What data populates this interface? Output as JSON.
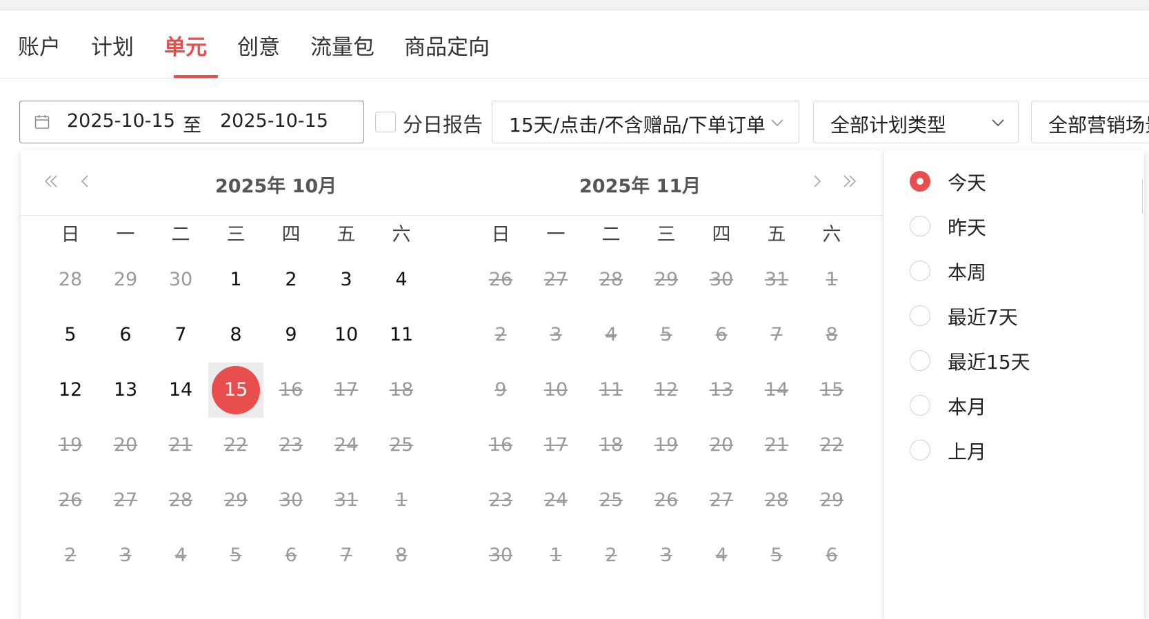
{
  "tabs": {
    "items": [
      {
        "label": "账户",
        "active": false
      },
      {
        "label": "计划",
        "active": false
      },
      {
        "label": "单元",
        "active": true
      },
      {
        "label": "创意",
        "active": false
      },
      {
        "label": "流量包",
        "active": false
      },
      {
        "label": "商品定向",
        "active": false
      }
    ]
  },
  "filters": {
    "date_start": "2025-10-15",
    "date_separator": "至",
    "date_end": "2025-10-15",
    "daily_report_label": "分日报告",
    "daily_report_checked": false,
    "attribution_select": "15天/点击/不含赠品/下单订单",
    "plan_type_select": "全部计划类型",
    "scene_select": "全部营销场景"
  },
  "calendar": {
    "weekdays": [
      "日",
      "一",
      "二",
      "三",
      "四",
      "五",
      "六"
    ],
    "selected_date": "2025-10-15",
    "months": [
      {
        "title": "2025年 10月",
        "weeks": [
          [
            "28",
            "29",
            "30",
            "1",
            "2",
            "3",
            "4"
          ],
          [
            "5",
            "6",
            "7",
            "8",
            "9",
            "10",
            "11"
          ],
          [
            "12",
            "13",
            "14",
            "15",
            "16",
            "17",
            "18"
          ],
          [
            "19",
            "20",
            "21",
            "22",
            "23",
            "24",
            "25"
          ],
          [
            "26",
            "27",
            "28",
            "29",
            "30",
            "31",
            "1"
          ],
          [
            "2",
            "3",
            "4",
            "5",
            "6",
            "7",
            "8"
          ]
        ]
      },
      {
        "title": "2025年 11月",
        "weeks": [
          [
            "26",
            "27",
            "28",
            "29",
            "30",
            "31",
            "1"
          ],
          [
            "2",
            "3",
            "4",
            "5",
            "6",
            "7",
            "8"
          ],
          [
            "9",
            "10",
            "11",
            "12",
            "13",
            "14",
            "15"
          ],
          [
            "16",
            "17",
            "18",
            "19",
            "20",
            "21",
            "22"
          ],
          [
            "23",
            "24",
            "25",
            "26",
            "27",
            "28",
            "29"
          ],
          [
            "30",
            "1",
            "2",
            "3",
            "4",
            "5",
            "6"
          ]
        ]
      }
    ]
  },
  "quick_ranges": [
    {
      "label": "今天",
      "selected": true
    },
    {
      "label": "昨天",
      "selected": false
    },
    {
      "label": "本周",
      "selected": false
    },
    {
      "label": "最近7天",
      "selected": false
    },
    {
      "label": "最近15天",
      "selected": false
    },
    {
      "label": "本月",
      "selected": false
    },
    {
      "label": "上月",
      "selected": false
    }
  ],
  "colors": {
    "accent": "#e84e4e",
    "text": "#222222",
    "muted": "#9a9a9a",
    "border": "#d9d9d9"
  },
  "icons": {
    "date_input": "calendar-icon",
    "select_arrow": "chevron-down-icon",
    "nav_prev_year": "double-chevron-left-icon",
    "nav_prev_month": "chevron-left-icon",
    "nav_next_month": "chevron-right-icon",
    "nav_next_year": "double-chevron-right-icon"
  }
}
